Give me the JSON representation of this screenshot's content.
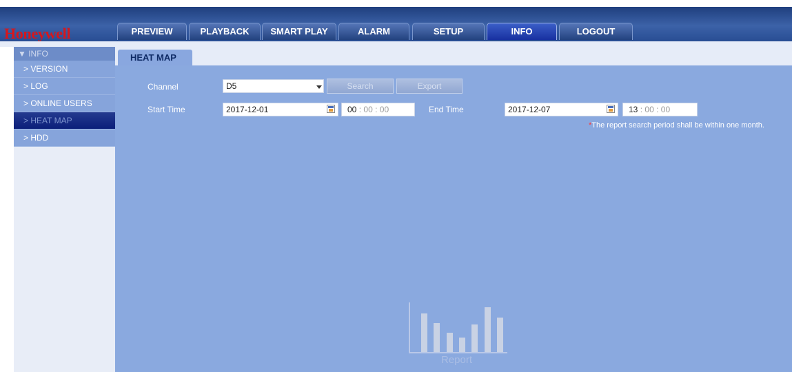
{
  "brand": {
    "name": "Honeywell"
  },
  "nav": {
    "tabs": [
      {
        "label": "PREVIEW"
      },
      {
        "label": "PLAYBACK"
      },
      {
        "label": "SMART PLAY"
      },
      {
        "label": "ALARM"
      },
      {
        "label": "SETUP"
      },
      {
        "label": "INFO"
      },
      {
        "label": "LOGOUT"
      }
    ],
    "active": "INFO"
  },
  "sidebar": {
    "header": "▼ INFO",
    "items": [
      {
        "label": "> VERSION"
      },
      {
        "label": "> LOG"
      },
      {
        "label": "> ONLINE USERS"
      },
      {
        "label": "> HEAT MAP"
      },
      {
        "label": "> HDD"
      }
    ],
    "active": "> HEAT MAP"
  },
  "page": {
    "subtab": "HEAT MAP",
    "channel_label": "Channel",
    "channel_value": "D5",
    "search_label": "Search",
    "export_label": "Export",
    "start_label": "Start Time",
    "start_date": "2017-12-01",
    "start_hour": "00",
    "start_min": "00",
    "start_sec": "00",
    "end_label": "End Time",
    "end_date": "2017-12-07",
    "end_hour": "13",
    "end_min": "00",
    "end_sec": "00",
    "time_sep": ":",
    "note_star": "*",
    "note_text": "The report search period shall be within one month.",
    "report_label": "Report"
  },
  "colors": {
    "accent": "#1830a0",
    "brand_red": "#d8161b",
    "content_bg": "#8aa9df"
  },
  "icons": {
    "calendar": "calendar-icon",
    "dropdown": "chevron-down-icon",
    "report": "bar-chart-icon"
  }
}
